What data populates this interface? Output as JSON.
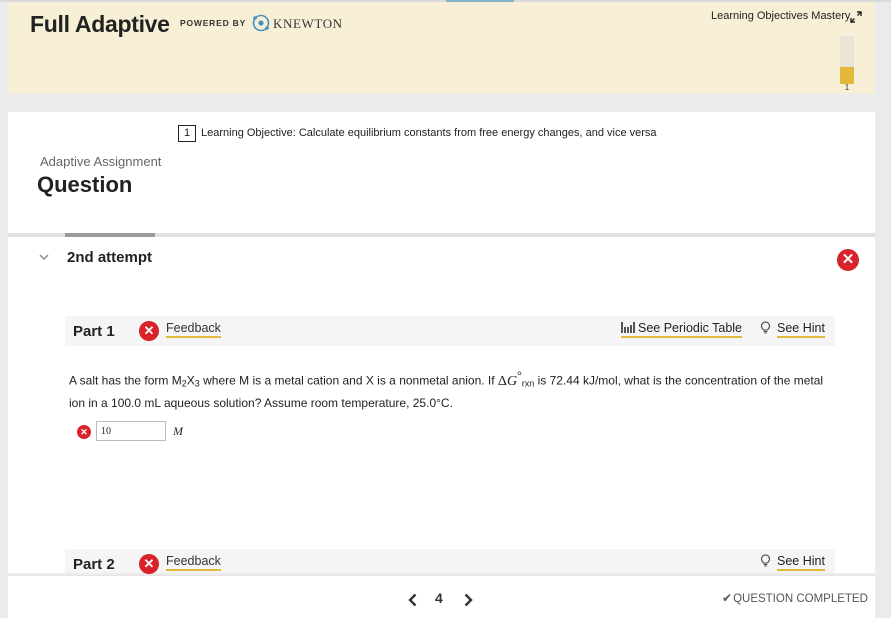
{
  "header": {
    "app_title": "Full Adaptive",
    "powered_by": "POWERED BY",
    "brand": "KNEWTON",
    "mastery_label": "Learning Objectives Mastery",
    "mastery_level": 0.35,
    "mastery_count": "1",
    "accent_color": "#e2b93b"
  },
  "objective": {
    "number": "1",
    "text": "Learning Objective: Calculate equilibrium constants from free energy changes, and vice versa"
  },
  "assignment": {
    "label": "Adaptive Assignment",
    "title": "Question"
  },
  "attempt": {
    "label": "2nd attempt",
    "status_icon": "error-icon"
  },
  "parts": [
    {
      "label": "Part 1",
      "feedback_label": "Feedback",
      "periodic_label": "See Periodic Table",
      "hint_label": "See Hint",
      "question": {
        "t1": "A salt has the form M",
        "s1": "2",
        "t2": "X",
        "s2": "3",
        "t3": " where M is a metal cation and X is a nonmetal anion. If ",
        "delta": "Δ",
        "g": "G",
        "sup": "°",
        "sub": "rxn",
        "t4": " is 72.44 kJ/mol, what is the concentration of the metal ion in a 100.0 mL aqueous solution? Assume room temperature, 25.0°C."
      },
      "answer_value": "10",
      "answer_unit": "M"
    },
    {
      "label": "Part 2",
      "feedback_label": "Feedback",
      "hint_label": "See Hint"
    }
  ],
  "footer": {
    "page": "4",
    "status": "QUESTION COMPLETED",
    "check": "✔"
  }
}
